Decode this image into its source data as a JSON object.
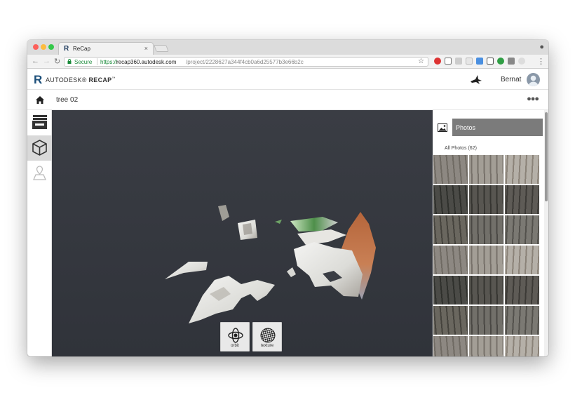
{
  "browser": {
    "tab_title": "ReCap",
    "tab_favicon": "R",
    "tab_close": "×",
    "secure_label": "Secure",
    "url_scheme": "https://",
    "url_host": "recap360.autodesk.com",
    "url_path": "/project/2228627a344f4cb0a6d25577b3e66b2c"
  },
  "app": {
    "logo_mark": "R",
    "brand_prefix": "AUTODESK",
    "brand_product": "RECAP",
    "user_name": "Bernat"
  },
  "project": {
    "title": "tree 02"
  },
  "rail": {
    "items": [
      "home-icon",
      "inbox-icon",
      "cube-icon",
      "map-pin-icon"
    ],
    "active_index": 2
  },
  "viewport": {
    "buttons": [
      {
        "label": "orbit",
        "icon": "orbit-icon"
      },
      {
        "label": "texture",
        "icon": "texture-icon"
      }
    ]
  },
  "photos_panel": {
    "header": "Photos",
    "count_label": "All Photos (62)"
  }
}
